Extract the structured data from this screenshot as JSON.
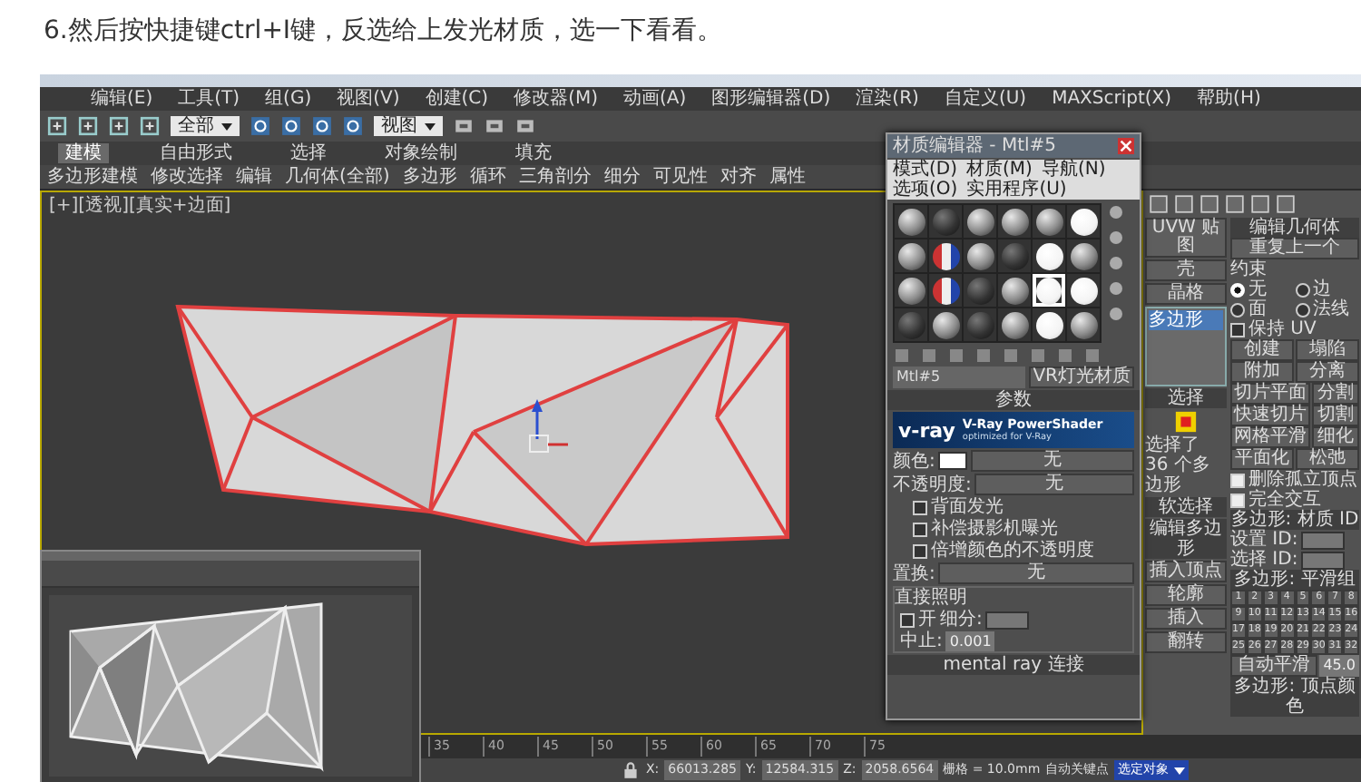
{
  "caption": "6.然后按快捷键ctrl+I键，反选给上发光材质，选一下看看。",
  "app": {
    "menu": [
      "编辑(E)",
      "工具(T)",
      "组(G)",
      "视图(V)",
      "创建(C)",
      "修改器(M)",
      "动画(A)",
      "图形编辑器(D)",
      "渲染(R)",
      "自定义(U)",
      "MAXScript(X)",
      "帮助(H)"
    ],
    "toolbar": {
      "dropdowns": [
        "全部",
        "视图"
      ]
    },
    "ribbon_tabs": [
      {
        "label": "建模",
        "selected": true
      },
      {
        "label": "自由形式",
        "selected": false
      },
      {
        "label": "选择",
        "selected": false
      },
      {
        "label": "对象绘制",
        "selected": false
      },
      {
        "label": "填充",
        "selected": false
      }
    ],
    "ribbon_tools": [
      "多边形建模",
      "修改选择",
      "编辑",
      "几何体(全部)",
      "多边形",
      "循环",
      "三角剖分",
      "细分",
      "可见性",
      "对齐",
      "属性"
    ],
    "viewport": {
      "label": "[+][透视][真实+边面]"
    },
    "material_editor": {
      "title": "材质编辑器 - Mtl#5",
      "menu": [
        "模式(D)",
        "材质(M)",
        "导航(N)",
        "选项(O)",
        "实用程序(U)"
      ],
      "slots": [
        {
          "kind": "gray",
          "selected": false
        },
        {
          "kind": "dark",
          "selected": false
        },
        {
          "kind": "gray",
          "selected": false
        },
        {
          "kind": "gray",
          "selected": false
        },
        {
          "kind": "gray",
          "selected": false
        },
        {
          "kind": "white",
          "selected": false
        },
        {
          "kind": "gray",
          "selected": false
        },
        {
          "kind": "multi",
          "selected": false
        },
        {
          "kind": "gray",
          "selected": false
        },
        {
          "kind": "dark",
          "selected": false
        },
        {
          "kind": "white",
          "selected": false
        },
        {
          "kind": "gray",
          "selected": false
        },
        {
          "kind": "gray",
          "selected": false
        },
        {
          "kind": "multi",
          "selected": false
        },
        {
          "kind": "dark",
          "selected": false
        },
        {
          "kind": "gray",
          "selected": false
        },
        {
          "kind": "white",
          "selected": true
        },
        {
          "kind": "white",
          "selected": false
        },
        {
          "kind": "dark",
          "selected": false
        },
        {
          "kind": "gray",
          "selected": false
        },
        {
          "kind": "dark",
          "selected": false
        },
        {
          "kind": "gray",
          "selected": false
        },
        {
          "kind": "white",
          "selected": false
        },
        {
          "kind": "gray",
          "selected": false
        }
      ],
      "material_name": "Mtl#5",
      "material_type": "VR灯光材质",
      "rollout": "参数",
      "banner": {
        "logo": "v-ray",
        "title": "V-Ray PowerShader",
        "subtitle": "optimized for V-Ray"
      },
      "params": [
        {
          "kind": "color",
          "label": "颜色:",
          "map": "无"
        },
        {
          "kind": "map",
          "label": "不透明度:",
          "map": "无"
        },
        {
          "kind": "check",
          "label": "背面发光",
          "checked": false
        },
        {
          "kind": "check",
          "label": "补偿摄影机曝光",
          "checked": false
        },
        {
          "kind": "check",
          "label": "倍增颜色的不透明度",
          "checked": false
        },
        {
          "kind": "map",
          "label": "置换:",
          "map": "无"
        }
      ],
      "direct": {
        "title": "直接照明",
        "on_label": "开",
        "on": false,
        "subdivs_label": "细分:",
        "cutoff_label": "中止:",
        "cutoff": "0.001"
      },
      "footer": "mental ray 连接"
    },
    "command_panel": {
      "left": {
        "buttons": [
          "UVW 贴图",
          "壳",
          "晶格"
        ],
        "stack": [
          {
            "label": "多边形",
            "selected": true
          }
        ],
        "selection_title": "选择",
        "selection_info": "选择了 36 个多边形",
        "rollouts": [
          "软选择",
          "编辑多边形"
        ],
        "tools": [
          "插入顶点",
          "轮廓",
          "插入",
          "翻转"
        ]
      },
      "right": [
        {
          "kind": "rollout",
          "label": "编辑几何体"
        },
        {
          "kind": "buttons",
          "labels": [
            "重复上一个"
          ]
        },
        {
          "kind": "label",
          "label": "约束"
        },
        {
          "kind": "radios",
          "options": [
            {
              "label": "无",
              "selected": true
            },
            {
              "label": "边",
              "selected": false
            },
            {
              "label": "面",
              "selected": false
            },
            {
              "label": "法线",
              "selected": false
            }
          ]
        },
        {
          "kind": "check",
          "label": "保持 UV",
          "checked": false
        },
        {
          "kind": "buttons",
          "labels": [
            "创建",
            "塌陷"
          ]
        },
        {
          "kind": "buttons",
          "labels": [
            "附加",
            "分离"
          ]
        },
        {
          "kind": "buttons",
          "labels": [
            "切片平面",
            "分割"
          ]
        },
        {
          "kind": "buttons",
          "labels": [
            "快速切片",
            "切割"
          ]
        },
        {
          "kind": "buttons",
          "labels": [
            "网格平滑",
            "细化"
          ]
        },
        {
          "kind": "buttons",
          "labels": [
            "平面化",
            "松弛"
          ]
        },
        {
          "kind": "check",
          "label": "删除孤立顶点",
          "checked": true
        },
        {
          "kind": "check",
          "label": "完全交互",
          "checked": true
        },
        {
          "kind": "rollout",
          "label": "多边形: 材质 ID"
        },
        {
          "kind": "spinner",
          "label": "设置 ID:"
        },
        {
          "kind": "spinner",
          "label": "选择 ID:"
        },
        {
          "kind": "rollout",
          "label": "多边形: 平滑组"
        },
        {
          "kind": "numgrid",
          "numbers": [
            "1",
            "2",
            "3",
            "4",
            "5",
            "6",
            "7",
            "8",
            "9",
            "10",
            "11",
            "12",
            "13",
            "14",
            "15",
            "16",
            "17",
            "18",
            "19",
            "20",
            "21",
            "22",
            "23",
            "24",
            "25",
            "26",
            "27",
            "28",
            "29",
            "30",
            "31",
            "32"
          ]
        },
        {
          "kind": "field",
          "label": "自动平滑",
          "value": "45.0"
        },
        {
          "kind": "rollout",
          "label": "多边形: 顶点颜色"
        }
      ]
    },
    "timeline": {
      "ticks": [
        "35",
        "40",
        "45",
        "50",
        "55",
        "60",
        "65",
        "70",
        "75"
      ]
    },
    "status_bar": {
      "coords": [
        {
          "label": "X:",
          "value": "66013.285"
        },
        {
          "label": "Y:",
          "value": "12584.315"
        },
        {
          "label": "Z:",
          "value": "2058.6564"
        }
      ],
      "grid": "栅格 = 10.0mm",
      "auto_key": "自动关键点",
      "key_mode": "选定对象"
    }
  }
}
